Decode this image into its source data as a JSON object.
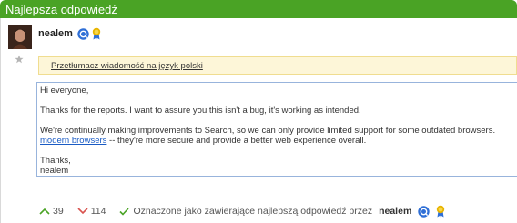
{
  "header": {
    "title": "Najlepsza odpowiedź"
  },
  "post": {
    "author": "nealem",
    "translate_link": "Przetłumacz wiadomość na język polski",
    "message": {
      "greeting": "Hi everyone,",
      "line1": "Thanks for the reports. I want to assure you this isn't a bug, it's working as intended.",
      "line2": "We're continually making improvements to Search, so we can only provide limited support for some outdated browsers.",
      "link": "modern browsers",
      "line3_rest": " -- they're more secure and provide a better web experience overall.",
      "closing": "Thanks,",
      "signature": "nealem"
    }
  },
  "footer": {
    "upvotes": "39",
    "downvotes": "114",
    "accepted_text": "Oznaczone jako zawierające najlepszą odpowiedź przez",
    "accepted_by": "nealem"
  },
  "colors": {
    "header_green": "#4aa325",
    "upvote": "#4aa325",
    "downvote": "#d9534f",
    "badge_blue": "#2f6fd6"
  }
}
